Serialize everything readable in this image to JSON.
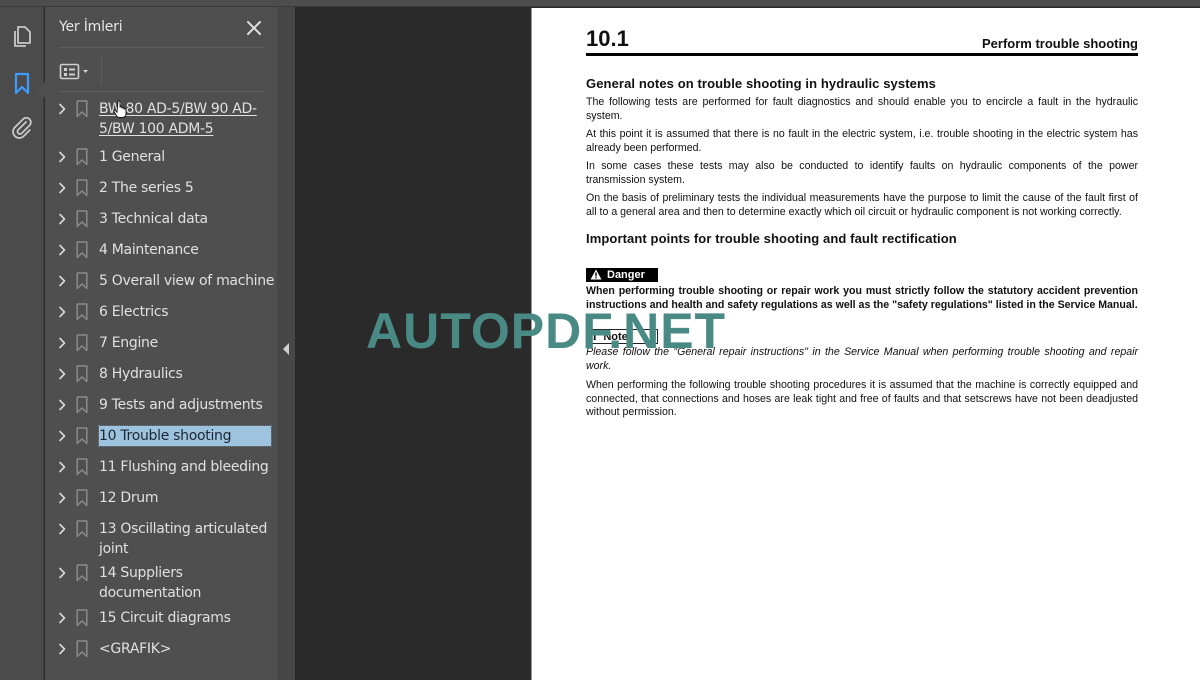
{
  "rail": {
    "icons": [
      {
        "name": "pages-icon",
        "active": false
      },
      {
        "name": "bookmark-icon",
        "active": true
      },
      {
        "name": "attachment-icon",
        "active": false
      }
    ],
    "active_color": "#3d9bff"
  },
  "panel": {
    "title": "Yer İmleri",
    "close_icon": "close-icon",
    "options_icon": "list-options-icon",
    "items": [
      {
        "label": "BW 80 AD-5/BW 90 AD-5/BW 100 ADM-5",
        "link": true,
        "selected": false
      },
      {
        "label": "1 General",
        "link": false,
        "selected": false
      },
      {
        "label": "2 The series 5",
        "link": false,
        "selected": false
      },
      {
        "label": "3 Technical data",
        "link": false,
        "selected": false
      },
      {
        "label": "4 Maintenance",
        "link": false,
        "selected": false
      },
      {
        "label": "5 Overall view of machine",
        "link": false,
        "selected": false
      },
      {
        "label": "6 Electrics",
        "link": false,
        "selected": false
      },
      {
        "label": "7 Engine",
        "link": false,
        "selected": false
      },
      {
        "label": "8 Hydraulics",
        "link": false,
        "selected": false
      },
      {
        "label": "9 Tests and adjustments",
        "link": false,
        "selected": false
      },
      {
        "label": "10 Trouble shooting",
        "link": false,
        "selected": true
      },
      {
        "label": "11 Flushing and bleeding",
        "link": false,
        "selected": false
      },
      {
        "label": "12 Drum",
        "link": false,
        "selected": false
      },
      {
        "label": "13 Oscillating articulated joint",
        "link": false,
        "selected": false
      },
      {
        "label": "14 Suppliers documentation",
        "link": false,
        "selected": false
      },
      {
        "label": "15 Circuit diagrams",
        "link": false,
        "selected": false
      },
      {
        "label": "<GRAFIK>",
        "link": false,
        "selected": false
      }
    ],
    "selected_color": "#9dc3de"
  },
  "page": {
    "section_number": "10.1",
    "section_title": "Perform trouble shooting",
    "heading1": "General notes on trouble shooting in hydraulic systems",
    "para1": "The following tests are performed for fault diagnostics and should enable you to encircle a fault in the hydraulic system.",
    "para2": "At this point it is assumed that there is no fault in the electric system, i.e. trouble shooting in the electric system has already been performed.",
    "para3": "In some cases these tests may also be conducted to identify faults on hydraulic components of the power transmission system.",
    "para4": "On the basis of preliminary tests the individual measurements have the purpose to limit the cause of the fault first of all to a general area and then to determine exactly which oil circuit or hydraulic component is not working correctly.",
    "heading2": "Important points for trouble shooting and fault rectification",
    "danger_label": "Danger",
    "danger_text": "When performing trouble shooting or repair work you must strictly follow the statutory accident prevention instructions and health and safety regulations as well as the \"safety regulations\" listed in the Service Manual.",
    "note_icon": "i",
    "note_label": "Note",
    "note_text": "Please follow the \"General repair instructions\" in the Service Manual when performing trouble shooting and repair work.",
    "para5": "When performing the following trouble shooting procedures it is assumed that the machine is correctly equipped and connected, that connections and hoses are leak tight and free of faults and that setscrews have not been deadjusted without permission."
  },
  "watermark": {
    "text": "AUTOPDF.NET",
    "color": "#4a8a84"
  }
}
